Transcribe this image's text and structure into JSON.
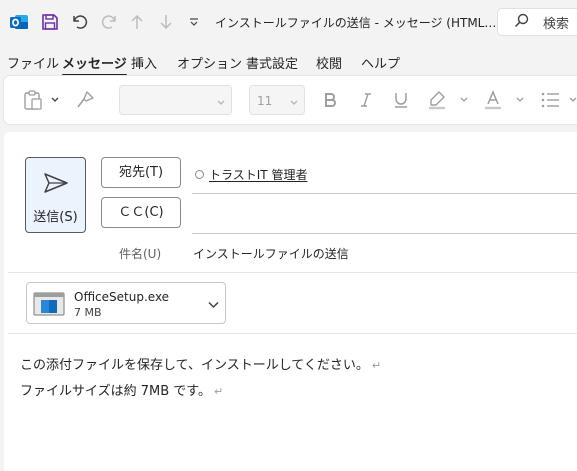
{
  "titlebar": {
    "title": "インストールファイルの送信 - メッセージ (HTML…",
    "search_label": "検索",
    "icons": [
      "outlook-app-icon",
      "save-icon",
      "undo-icon",
      "redo-icon",
      "up-icon",
      "down-icon",
      "qat-more-icon",
      "search-icon"
    ]
  },
  "menu": {
    "tabs": [
      {
        "label": "ファイル",
        "active": false
      },
      {
        "label": "メッセージ",
        "active": true
      },
      {
        "label": "挿入",
        "active": false
      },
      {
        "label": "オプション",
        "active": false
      },
      {
        "label": "書式設定",
        "active": false
      },
      {
        "label": "校閲",
        "active": false
      },
      {
        "label": "ヘルプ",
        "active": false
      }
    ]
  },
  "ribbon": {
    "font_name_value": "",
    "font_size_value": "11",
    "icons": [
      "paste-icon",
      "format-painter-icon",
      "bold-icon",
      "italic-icon",
      "underline-icon",
      "highlight-icon",
      "font-color-icon",
      "bullets-icon"
    ]
  },
  "compose": {
    "send_label": "送信(S)",
    "to_button_label": "宛先(T)",
    "cc_button_label": "ＣＣ(C)",
    "recipient": "トラストIT 管理者",
    "subject_label": "件名(U)",
    "subject_value": "インストールファイルの送信"
  },
  "attachment": {
    "file_name": "OfficeSetup.exe",
    "file_size": "7 MB"
  },
  "body": {
    "lines": [
      "この添付ファイルを保存して、インストールしてください。",
      "ファイルサイズは約 7MB です。"
    ],
    "paragraph_mark": "↵"
  },
  "colors": {
    "accent": "#0f6cbd",
    "save_icon": "#6b2fa5",
    "send_button_bg": "#ebf3fc",
    "window_bg": "#f3f3f3"
  }
}
